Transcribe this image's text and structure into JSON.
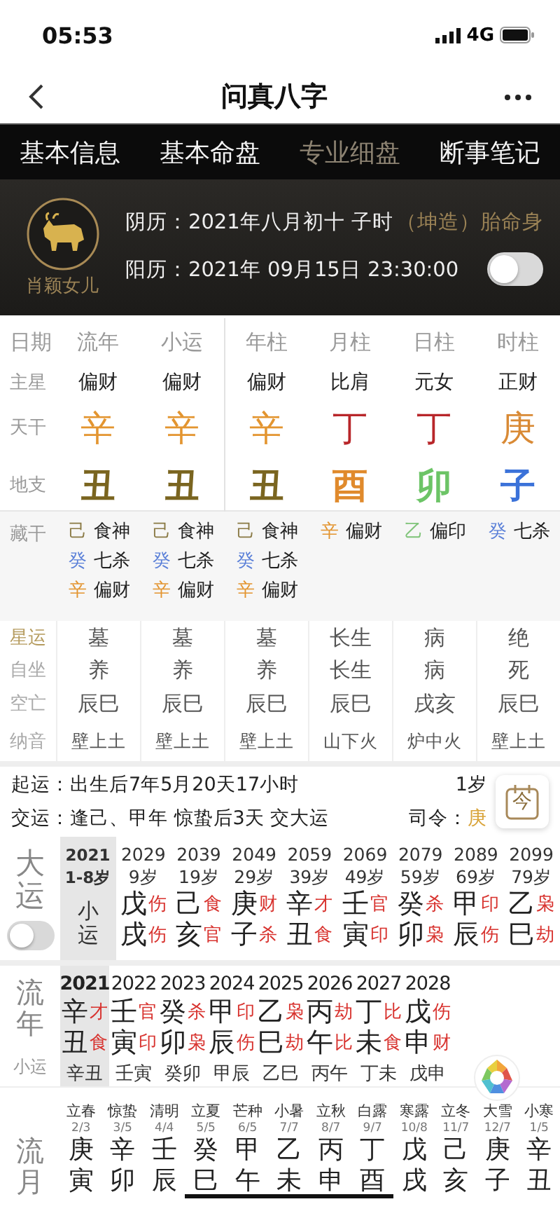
{
  "status_bar": {
    "time": "05:53",
    "network": "4G"
  },
  "nav": {
    "title": "问真八字"
  },
  "tabs": [
    {
      "label": "基本信息",
      "selected": false
    },
    {
      "label": "基本命盘",
      "selected": false
    },
    {
      "label": "专业细盘",
      "selected": true
    },
    {
      "label": "断事笔记",
      "selected": false
    }
  ],
  "profile": {
    "avatar_caption": "肖颖女儿",
    "lunar": "阴历：2021年八月初十  子时",
    "lunar_tag": "（坤造）胎命身",
    "solar": "阳历：2021年 09月15日 23:30:00",
    "toggle_on": false
  },
  "pillars": {
    "row_labels": [
      "日期",
      "主星",
      "天干",
      "地支"
    ],
    "columns": [
      {
        "title": "流年",
        "star": "偏财",
        "stem": {
          "char": "辛",
          "color": "#e39530"
        },
        "branch": {
          "char": "丑",
          "color": "#7a6520"
        }
      },
      {
        "title": "小运",
        "star": "偏财",
        "stem": {
          "char": "辛",
          "color": "#e39530"
        },
        "branch": {
          "char": "丑",
          "color": "#7a6520"
        }
      },
      {
        "title": "年柱",
        "star": "偏财",
        "stem": {
          "char": "辛",
          "color": "#e39530"
        },
        "branch": {
          "char": "丑",
          "color": "#7a6520"
        }
      },
      {
        "title": "月柱",
        "star": "比肩",
        "stem": {
          "char": "丁",
          "color": "#b8262a"
        },
        "branch": {
          "char": "酉",
          "color": "#e08a2c"
        }
      },
      {
        "title": "日柱",
        "star": "元女",
        "stem": {
          "char": "丁",
          "color": "#b8262a"
        },
        "branch": {
          "char": "卯",
          "color": "#6cc466"
        }
      },
      {
        "title": "时柱",
        "star": "正财",
        "stem": {
          "char": "庚",
          "color": "#d98a35"
        },
        "branch": {
          "char": "子",
          "color": "#3b72d9"
        }
      }
    ]
  },
  "hidden_stems": {
    "label": "藏干",
    "columns": [
      [
        {
          "char": "己",
          "color": "#8a7a45",
          "god": "食神"
        },
        {
          "char": "癸",
          "color": "#5b80d8",
          "god": "七杀"
        },
        {
          "char": "辛",
          "color": "#e39530",
          "god": "偏财"
        }
      ],
      [
        {
          "char": "己",
          "color": "#8a7a45",
          "god": "食神"
        },
        {
          "char": "癸",
          "color": "#5b80d8",
          "god": "七杀"
        },
        {
          "char": "辛",
          "color": "#e39530",
          "god": "偏财"
        }
      ],
      [
        {
          "char": "己",
          "color": "#8a7a45",
          "god": "食神"
        },
        {
          "char": "癸",
          "color": "#5b80d8",
          "god": "七杀"
        },
        {
          "char": "辛",
          "color": "#e39530",
          "god": "偏财"
        }
      ],
      [
        {
          "char": "辛",
          "color": "#e39530",
          "god": "偏财"
        }
      ],
      [
        {
          "char": "乙",
          "color": "#80c47a",
          "god": "偏印"
        }
      ],
      [
        {
          "char": "癸",
          "color": "#5b80d8",
          "god": "七杀"
        }
      ]
    ]
  },
  "stages": {
    "labels": [
      {
        "text": "星运",
        "selected": true
      },
      {
        "text": "自坐",
        "selected": false
      },
      {
        "text": "空亡",
        "selected": false
      },
      {
        "text": "纳音",
        "selected": false
      }
    ],
    "columns": [
      {
        "xingyun": "墓",
        "zizuo": "养",
        "kongwang": "辰巳",
        "nayin": "壁上土"
      },
      {
        "xingyun": "墓",
        "zizuo": "养",
        "kongwang": "辰巳",
        "nayin": "壁上土"
      },
      {
        "xingyun": "墓",
        "zizuo": "养",
        "kongwang": "辰巳",
        "nayin": "壁上土"
      },
      {
        "xingyun": "长生",
        "zizuo": "长生",
        "kongwang": "辰巳",
        "nayin": "山下火"
      },
      {
        "xingyun": "病",
        "zizuo": "病",
        "kongwang": "戌亥",
        "nayin": "炉中火"
      },
      {
        "xingyun": "绝",
        "zizuo": "死",
        "kongwang": "辰巳",
        "nayin": "壁上土"
      }
    ]
  },
  "luck_info": {
    "qiyun": "起运：出生后7年5月20天17小时",
    "jiaoyun": "交运：逢己、甲年 惊蛰后3天 交大运",
    "age": "1岁",
    "siling_label": "司令：",
    "siling": "庚",
    "today_button": "今"
  },
  "dayun": {
    "label": "大运",
    "toggle_on": false,
    "periods": [
      {
        "kind": "xiaoyun",
        "year": "2021",
        "age": "1-8岁",
        "text": "小运",
        "selected": true
      },
      {
        "kind": "pillar",
        "year": "2029",
        "age": "9岁",
        "stem": "戊",
        "stem_god": "伤",
        "branch": "戌",
        "branch_god": "伤",
        "selected": false
      },
      {
        "kind": "pillar",
        "year": "2039",
        "age": "19岁",
        "stem": "己",
        "stem_god": "食",
        "branch": "亥",
        "branch_god": "官",
        "selected": false
      },
      {
        "kind": "pillar",
        "year": "2049",
        "age": "29岁",
        "stem": "庚",
        "stem_god": "财",
        "branch": "子",
        "branch_god": "杀",
        "selected": false
      },
      {
        "kind": "pillar",
        "year": "2059",
        "age": "39岁",
        "stem": "辛",
        "stem_god": "才",
        "branch": "丑",
        "branch_god": "食",
        "selected": false
      },
      {
        "kind": "pillar",
        "year": "2069",
        "age": "49岁",
        "stem": "壬",
        "stem_god": "官",
        "branch": "寅",
        "branch_god": "印",
        "selected": false
      },
      {
        "kind": "pillar",
        "year": "2079",
        "age": "59岁",
        "stem": "癸",
        "stem_god": "杀",
        "branch": "卯",
        "branch_god": "枭",
        "selected": false
      },
      {
        "kind": "pillar",
        "year": "2089",
        "age": "69岁",
        "stem": "甲",
        "stem_god": "印",
        "branch": "辰",
        "branch_god": "伤",
        "selected": false
      },
      {
        "kind": "pillar",
        "year": "2099",
        "age": "79岁",
        "stem": "乙",
        "stem_god": "枭",
        "branch": "巳",
        "branch_god": "劫",
        "selected": false
      }
    ]
  },
  "liunian": {
    "label": "流年",
    "sub_label": "小运",
    "years": [
      {
        "year": "2021",
        "stem": "辛",
        "stem_god": "才",
        "branch": "丑",
        "branch_god": "食",
        "xiaoyun": "辛丑",
        "selected": true
      },
      {
        "year": "2022",
        "stem": "壬",
        "stem_god": "官",
        "branch": "寅",
        "branch_god": "印",
        "xiaoyun": "壬寅",
        "selected": false
      },
      {
        "year": "2023",
        "stem": "癸",
        "stem_god": "杀",
        "branch": "卯",
        "branch_god": "枭",
        "xiaoyun": "癸卯",
        "selected": false
      },
      {
        "year": "2024",
        "stem": "甲",
        "stem_god": "印",
        "branch": "辰",
        "branch_god": "伤",
        "xiaoyun": "甲辰",
        "selected": false
      },
      {
        "year": "2025",
        "stem": "乙",
        "stem_god": "枭",
        "branch": "巳",
        "branch_god": "劫",
        "xiaoyun": "乙巳",
        "selected": false
      },
      {
        "year": "2026",
        "stem": "丙",
        "stem_god": "劫",
        "branch": "午",
        "branch_god": "比",
        "xiaoyun": "丙午",
        "selected": false
      },
      {
        "year": "2027",
        "stem": "丁",
        "stem_god": "比",
        "branch": "未",
        "branch_god": "食",
        "xiaoyun": "丁未",
        "selected": false
      },
      {
        "year": "2028",
        "stem": "戊",
        "stem_god": "伤",
        "branch": "申",
        "branch_god": "财",
        "xiaoyun": "戊申",
        "selected": false
      }
    ]
  },
  "liuyue": {
    "label": "流月",
    "months": [
      {
        "term": "立春",
        "date": "2/3",
        "stem": "庚",
        "branch": "寅",
        "underlined": false
      },
      {
        "term": "惊蛰",
        "date": "3/5",
        "stem": "辛",
        "branch": "卯",
        "underlined": false
      },
      {
        "term": "清明",
        "date": "4/4",
        "stem": "壬",
        "branch": "辰",
        "underlined": false
      },
      {
        "term": "立夏",
        "date": "5/5",
        "stem": "癸",
        "branch": "巳",
        "underlined": true
      },
      {
        "term": "芒种",
        "date": "6/5",
        "stem": "甲",
        "branch": "午",
        "underlined": true
      },
      {
        "term": "小暑",
        "date": "7/7",
        "stem": "乙",
        "branch": "未",
        "underlined": true
      },
      {
        "term": "立秋",
        "date": "8/7",
        "stem": "丙",
        "branch": "申",
        "underlined": true
      },
      {
        "term": "白露",
        "date": "9/7",
        "stem": "丁",
        "branch": "酉",
        "underlined": true
      },
      {
        "term": "寒露",
        "date": "10/8",
        "stem": "戊",
        "branch": "戌",
        "underlined": false
      },
      {
        "term": "立冬",
        "date": "11/7",
        "stem": "己",
        "branch": "亥",
        "underlined": false
      },
      {
        "term": "大雪",
        "date": "12/7",
        "stem": "庚",
        "branch": "子",
        "underlined": false
      },
      {
        "term": "小寒",
        "date": "1/5",
        "stem": "辛",
        "branch": "丑",
        "underlined": false
      }
    ]
  }
}
